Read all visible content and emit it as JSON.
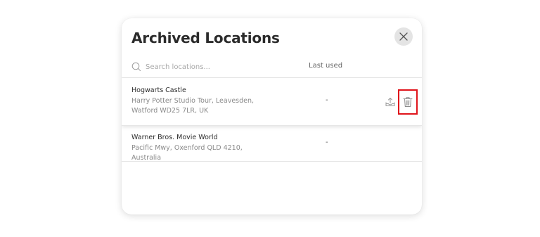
{
  "modal": {
    "title": "Archived Locations",
    "close_icon": "close-icon"
  },
  "search": {
    "placeholder": "Search locations...",
    "value": "",
    "icon": "search-icon"
  },
  "columns": {
    "last_used": "Last used"
  },
  "locations": [
    {
      "name": "Hogwarts Castle",
      "address": "Harry Potter Studio Tour, Leavesden, Watford WD25 7LR, UK",
      "last_used": "-",
      "actions": [
        "unarchive-icon",
        "trash-icon"
      ],
      "highlighted_action": "trash-icon"
    },
    {
      "name": "Warner Bros. Movie World",
      "address": "Pacific Mwy, Oxenford QLD 4210, Australia",
      "last_used": "-"
    }
  ],
  "colors": {
    "highlight_border": "#e0141b",
    "title": "#2b2b2b",
    "secondary_text": "#8a8a8a",
    "close_button_bg": "#e4e4e4"
  }
}
